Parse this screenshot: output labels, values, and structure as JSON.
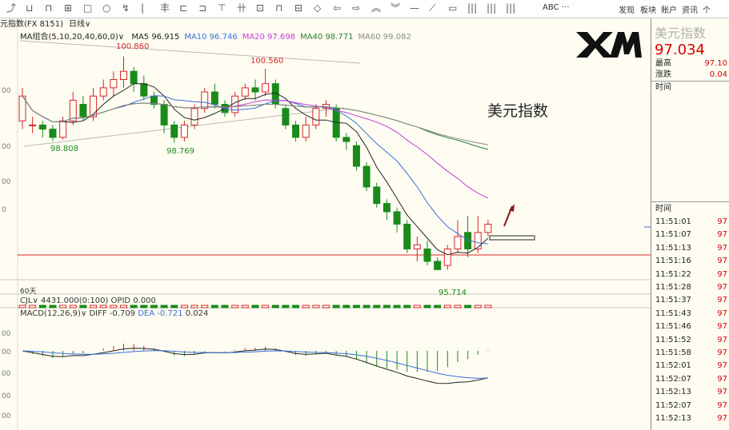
{
  "toolbar": {
    "icons": [
      "back-icon",
      "candle-icon",
      "bar-icon",
      "grid-icon",
      "square-icon",
      "circle-icon",
      "draw-icon",
      "line-icon",
      "fib-icon",
      "channel-icon",
      "hline-icon",
      "text-icon",
      "rect-icon",
      "ellipse-icon",
      "arrow-icon",
      "up-icon",
      "diamond-icon",
      "left-icon",
      "right-icon",
      "double-up-icon",
      "double-down-icon",
      "minus-icon",
      "pen-icon",
      "box-icon",
      "bars-icon",
      "bars2-icon",
      "bars3-icon",
      "more-icon"
    ],
    "abc_label": "ABC",
    "more_label": "···",
    "right_items": [
      "发现",
      "板块",
      "账户",
      "资讯",
      "个"
    ]
  },
  "chart": {
    "symbol_label": "元指数(FX 8151)",
    "period_label": "日线",
    "ma_label": "MA组合(5,10,20,40,60,0)",
    "ma_values": [
      {
        "name": "MA5",
        "value": "96.915",
        "color": "#222222"
      },
      {
        "name": "MA10",
        "value": "96.746",
        "color": "#3a6fd8"
      },
      {
        "name": "MA20",
        "value": "97.698",
        "color": "#c23ad8"
      },
      {
        "name": "MA40",
        "value": "98.771",
        "color": "#2e7d32"
      },
      {
        "name": "MA60",
        "value": "99.082",
        "color": "#888888"
      }
    ],
    "annotations": {
      "high1": "100.860",
      "high2": "100.560",
      "low1": "98.808",
      "low2": "98.769",
      "low3": "95.714"
    },
    "title_overlay": "美元指数",
    "axis_left": [
      "00",
      "00",
      "00",
      "0"
    ],
    "days_label": "60天",
    "volume_label": "CJL",
    "volume_values": "4431.000(0:100)  OPID 0.000",
    "macd_label": "MACD(12,26,9)",
    "macd_diff": "DIFF -0.709",
    "macd_dea": "DEA -0.721",
    "macd_value": "0.024",
    "macd_axis": [
      "00",
      "00",
      "00",
      "00",
      "00"
    ]
  },
  "panel": {
    "title": "美元指数",
    "price": "97.034",
    "high_label": "最高",
    "high_value": "97.10",
    "change_label": "涨跌",
    "change_value": "0.04",
    "time_label": "时间",
    "time_header": "时间",
    "ticks": [
      {
        "time": "11:51:01",
        "val": "97"
      },
      {
        "time": "11:51:07",
        "val": "97"
      },
      {
        "time": "11:51:13",
        "val": "97"
      },
      {
        "time": "11:51:16",
        "val": "97"
      },
      {
        "time": "11:51:22",
        "val": "97"
      },
      {
        "time": "11:51:28",
        "val": "97"
      },
      {
        "time": "11:51:37",
        "val": "97"
      },
      {
        "time": "11:51:43",
        "val": "97"
      },
      {
        "time": "11:51:46",
        "val": "97"
      },
      {
        "time": "11:51:52",
        "val": "97"
      },
      {
        "time": "11:51:58",
        "val": "97"
      },
      {
        "time": "11:52:01",
        "val": "97"
      },
      {
        "time": "11:52:07",
        "val": "97"
      },
      {
        "time": "11:52:13",
        "val": "97"
      },
      {
        "time": "11:52:07",
        "val": "97"
      },
      {
        "time": "11:52:13",
        "val": "97"
      }
    ]
  },
  "colors": {
    "up": "#d62728",
    "down": "#1a8a1a",
    "logo": "#111111"
  },
  "chart_data": {
    "type": "candlestick",
    "title": "美元指数",
    "candles": [
      {
        "o": 99.3,
        "c": 99.9,
        "h": 100.1,
        "l": 99.1
      },
      {
        "o": 99.2,
        "c": 99.2,
        "h": 99.4,
        "l": 99.0
      },
      {
        "o": 99.2,
        "c": 99.1,
        "h": 99.3,
        "l": 98.9
      },
      {
        "o": 99.1,
        "c": 98.9,
        "h": 99.2,
        "l": 98.808
      },
      {
        "o": 98.9,
        "c": 99.3,
        "h": 99.4,
        "l": 98.85
      },
      {
        "o": 99.3,
        "c": 99.8,
        "h": 100.0,
        "l": 99.2
      },
      {
        "o": 99.7,
        "c": 99.4,
        "h": 99.9,
        "l": 99.3
      },
      {
        "o": 99.4,
        "c": 99.9,
        "h": 100.1,
        "l": 99.3
      },
      {
        "o": 99.9,
        "c": 100.1,
        "h": 100.3,
        "l": 99.8
      },
      {
        "o": 100.1,
        "c": 100.3,
        "h": 100.5,
        "l": 99.9
      },
      {
        "o": 100.3,
        "c": 100.5,
        "h": 100.86,
        "l": 100.1
      },
      {
        "o": 100.5,
        "c": 100.2,
        "h": 100.6,
        "l": 100.0
      },
      {
        "o": 100.2,
        "c": 99.9,
        "h": 100.4,
        "l": 99.8
      },
      {
        "o": 99.9,
        "c": 99.7,
        "h": 100.0,
        "l": 99.6
      },
      {
        "o": 99.7,
        "c": 99.2,
        "h": 99.8,
        "l": 99.0
      },
      {
        "o": 99.2,
        "c": 98.9,
        "h": 99.3,
        "l": 98.769
      },
      {
        "o": 98.9,
        "c": 99.2,
        "h": 99.3,
        "l": 98.8
      },
      {
        "o": 99.2,
        "c": 99.6,
        "h": 99.7,
        "l": 99.1
      },
      {
        "o": 99.6,
        "c": 100.0,
        "h": 100.1,
        "l": 99.5
      },
      {
        "o": 100.0,
        "c": 99.7,
        "h": 100.2,
        "l": 99.6
      },
      {
        "o": 99.7,
        "c": 99.5,
        "h": 99.8,
        "l": 99.4
      },
      {
        "o": 99.5,
        "c": 99.9,
        "h": 100.0,
        "l": 99.4
      },
      {
        "o": 99.9,
        "c": 100.1,
        "h": 100.2,
        "l": 99.8
      },
      {
        "o": 100.1,
        "c": 100.0,
        "h": 100.3,
        "l": 99.8
      },
      {
        "o": 100.0,
        "c": 100.2,
        "h": 100.56,
        "l": 99.9
      },
      {
        "o": 100.2,
        "c": 99.7,
        "h": 100.3,
        "l": 99.6
      },
      {
        "o": 99.6,
        "c": 99.2,
        "h": 99.7,
        "l": 99.1
      },
      {
        "o": 99.2,
        "c": 98.9,
        "h": 99.3,
        "l": 98.8
      },
      {
        "o": 98.9,
        "c": 99.2,
        "h": 99.4,
        "l": 98.8
      },
      {
        "o": 99.2,
        "c": 99.6,
        "h": 99.7,
        "l": 99.1
      },
      {
        "o": 99.6,
        "c": 99.7,
        "h": 99.8,
        "l": 99.4
      },
      {
        "o": 99.6,
        "c": 98.9,
        "h": 99.7,
        "l": 98.8
      },
      {
        "o": 98.9,
        "c": 98.8,
        "h": 99.0,
        "l": 98.6
      },
      {
        "o": 98.7,
        "c": 98.2,
        "h": 98.8,
        "l": 98.1
      },
      {
        "o": 98.2,
        "c": 97.7,
        "h": 98.3,
        "l": 97.6
      },
      {
        "o": 97.7,
        "c": 97.3,
        "h": 97.8,
        "l": 97.2
      },
      {
        "o": 97.3,
        "c": 97.1,
        "h": 97.4,
        "l": 96.9
      },
      {
        "o": 97.1,
        "c": 96.8,
        "h": 97.2,
        "l": 96.6
      },
      {
        "o": 96.8,
        "c": 96.2,
        "h": 96.9,
        "l": 96.1
      },
      {
        "o": 96.2,
        "c": 96.3,
        "h": 96.5,
        "l": 95.9
      },
      {
        "o": 96.2,
        "c": 95.9,
        "h": 96.4,
        "l": 95.8
      },
      {
        "o": 95.9,
        "c": 95.7,
        "h": 96.0,
        "l": 95.714
      },
      {
        "o": 95.8,
        "c": 96.2,
        "h": 96.3,
        "l": 95.7
      },
      {
        "o": 96.2,
        "c": 96.5,
        "h": 96.9,
        "l": 96.1
      },
      {
        "o": 96.6,
        "c": 96.2,
        "h": 97.0,
        "l": 96.0
      },
      {
        "o": 96.2,
        "c": 96.6,
        "h": 97.0,
        "l": 96.1
      },
      {
        "o": 96.6,
        "c": 96.8,
        "h": 96.9,
        "l": 96.5
      }
    ],
    "ylim": [
      95.3,
      101.2
    ]
  }
}
